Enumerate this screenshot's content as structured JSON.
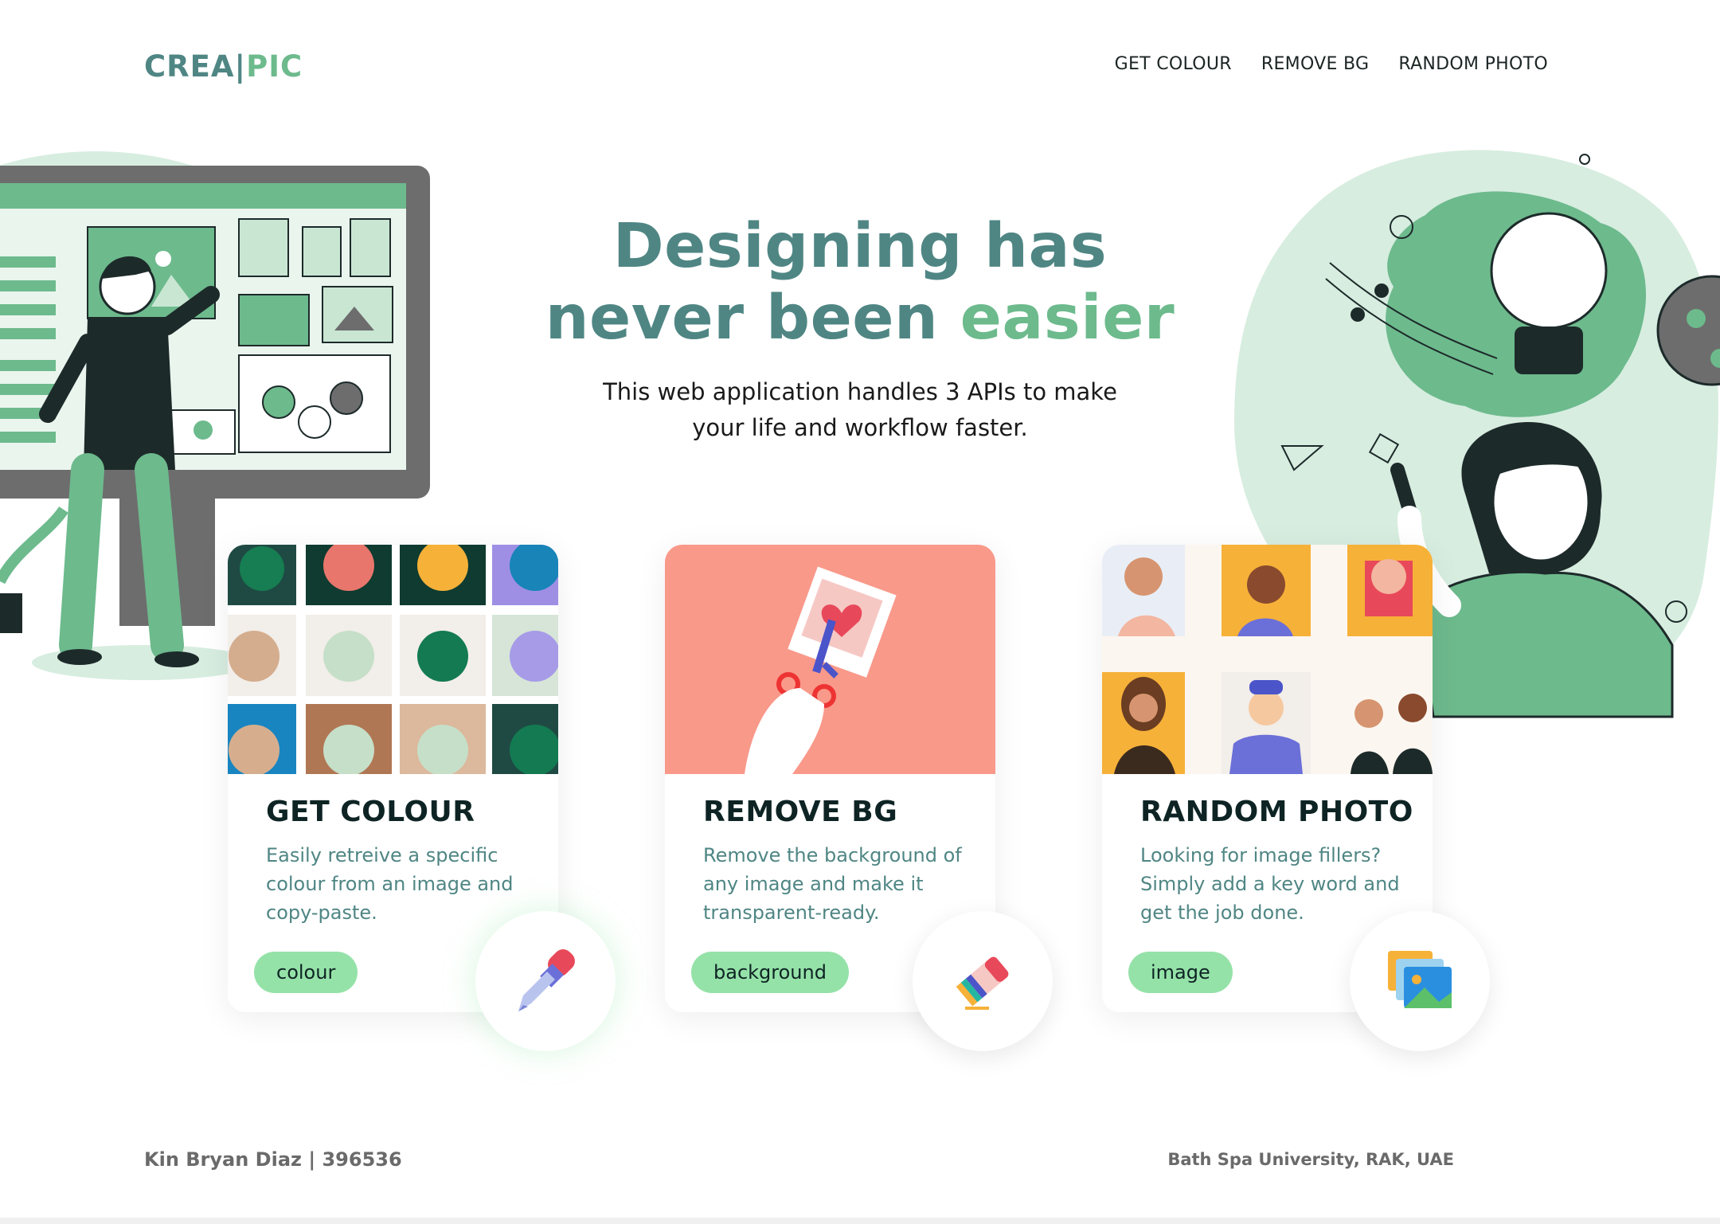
{
  "brand": {
    "part1": "CREA|",
    "part2": "PIC"
  },
  "nav": [
    "GET COLOUR",
    "REMOVE BG",
    "RANDOM PHOTO"
  ],
  "hero": {
    "title_line1": "Designing has",
    "title_line2_plain": "never been ",
    "title_line2_accent": "easier",
    "subtitle": "This web application handles 3 APIs to make your life and workflow faster."
  },
  "cards": [
    {
      "title": "GET COLOUR",
      "description": "Easily retreive a specific colour from an image and copy-paste.",
      "tag": "colour",
      "icon": "eyedropper-icon"
    },
    {
      "title": "REMOVE BG",
      "description": "Remove the background of any image and make it transparent-ready.",
      "tag": "background",
      "icon": "eraser-icon"
    },
    {
      "title": "RANDOM PHOTO",
      "description": "Looking for image fillers? Simply add a key word and get the job done.",
      "tag": "image",
      "icon": "images-icon"
    }
  ],
  "footer": {
    "left": "Kin Bryan Diaz | 396536",
    "right": "Bath Spa University, RAK, UAE"
  },
  "colors": {
    "primary": "#4f8684",
    "accent": "#6dba8d",
    "tag": "#95e2a8",
    "salmon": "#f9998a"
  }
}
